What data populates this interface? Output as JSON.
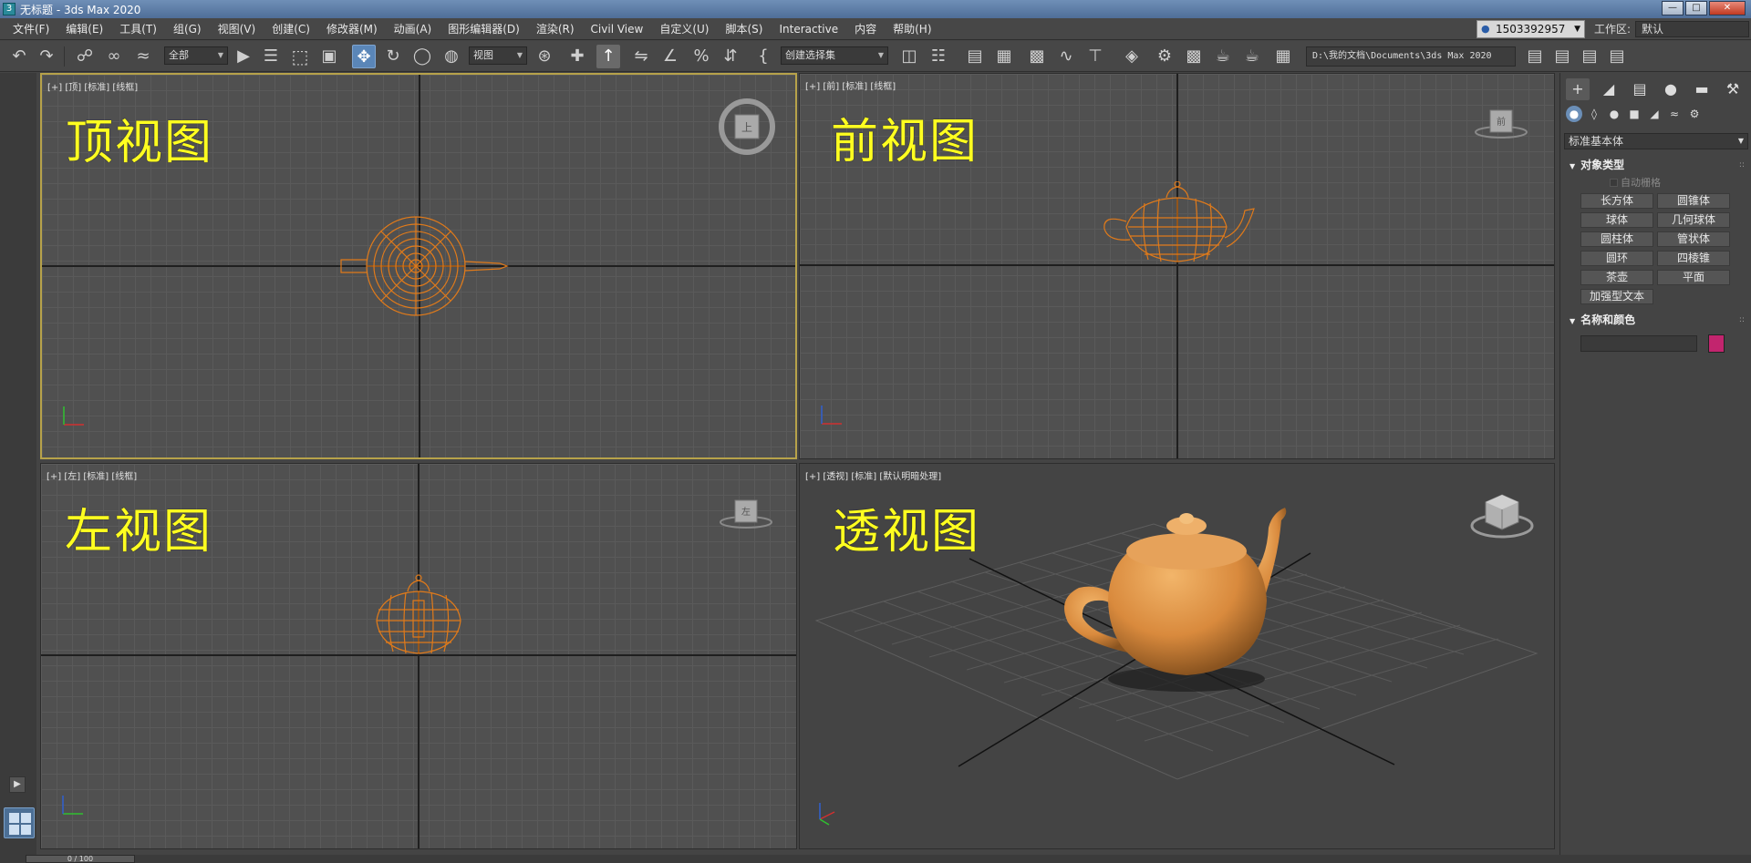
{
  "window": {
    "title": "无标题 - 3ds Max 2020",
    "icon": "3",
    "buttons": [
      "—",
      "□",
      "✕"
    ]
  },
  "menubar": {
    "items": [
      "文件(F)",
      "编辑(E)",
      "工具(T)",
      "组(G)",
      "视图(V)",
      "创建(C)",
      "修改器(M)",
      "动画(A)",
      "图形编辑器(D)",
      "渲染(R)",
      "Civil View",
      "自定义(U)",
      "脚本(S)",
      "Interactive",
      "内容",
      "帮助(H)"
    ],
    "account": "1503392957",
    "workspace_label": "工作区:",
    "workspace_value": "默认"
  },
  "toolbar": {
    "selection_filter": "全部",
    "ref_coord": "视图",
    "named_selection": "创建选择集",
    "project_path": "D:\\我的文档\\Documents\\3ds Max 2020",
    "icons": [
      "undo-icon",
      "redo-icon",
      "link-icon",
      "unlink-icon",
      "bind-spacewarp-icon",
      "select-object-icon",
      "select-by-name-icon",
      "rect-region-icon",
      "window-crossing-icon",
      "move-icon",
      "rotate-icon",
      "scale-icon",
      "placement-icon",
      "pivot-icon",
      "snap-icon",
      "angle-snap-icon",
      "percent-snap-icon",
      "spinner-snap-icon",
      "mirror-icon",
      "align-icon",
      "layer-icon",
      "scene-explorer-icon",
      "graphite-icon",
      "curve-editor-icon",
      "schematic-icon",
      "material-editor-icon",
      "render-setup-icon",
      "rendered-frame-icon",
      "render-icon",
      "render-online-icon"
    ]
  },
  "viewports": {
    "top": {
      "label": "[+] [顶] [标准] [线框]",
      "big_label": "顶视图",
      "cube": "上"
    },
    "front": {
      "label": "[+] [前] [标准] [线框]",
      "big_label": "前视图",
      "cube": "前"
    },
    "left": {
      "label": "[+] [左] [标准] [线框]",
      "big_label": "左视图",
      "cube": "左"
    },
    "persp": {
      "label": "[+] [透视] [标准] [默认明暗处理]",
      "big_label": "透视图"
    }
  },
  "command_panel": {
    "category": "标准基本体",
    "object_type_title": "对象类型",
    "autogrid": "自动栅格",
    "buttons": [
      "长方体",
      "圆锥体",
      "球体",
      "几何球体",
      "圆柱体",
      "管状体",
      "圆环",
      "四棱锥",
      "茶壶",
      "平面",
      "加强型文本"
    ],
    "name_color_title": "名称和颜色",
    "object_color": "#c2256e"
  },
  "timeline": {
    "frame": "0 / 100"
  },
  "colors": {
    "teapot": "#d98a3d",
    "wire": "#e07a1a",
    "active_border": "#b7a24a",
    "accent": "#5a86b8"
  }
}
